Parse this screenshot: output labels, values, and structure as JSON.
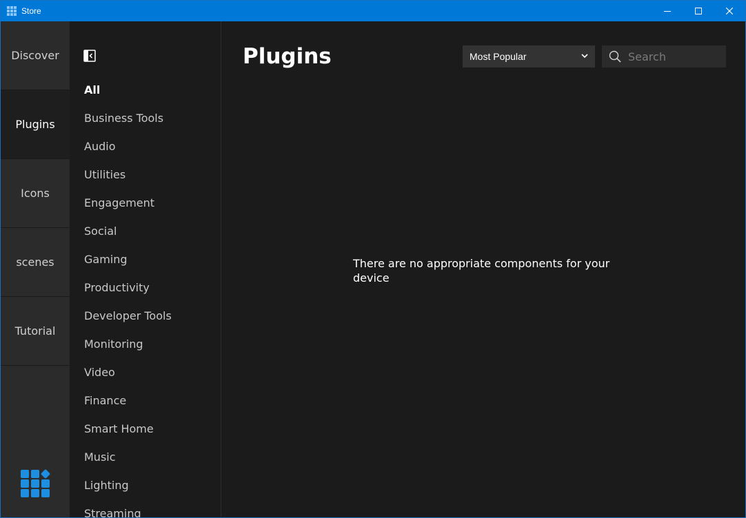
{
  "window": {
    "title": "Store"
  },
  "rail": {
    "items": [
      {
        "label": "Discover"
      },
      {
        "label": "Plugins"
      },
      {
        "label": "Icons"
      },
      {
        "label": "scenes"
      },
      {
        "label": "Tutorial"
      }
    ],
    "active": "Plugins"
  },
  "categories": {
    "items": [
      {
        "label": "All"
      },
      {
        "label": "Business Tools"
      },
      {
        "label": "Audio"
      },
      {
        "label": "Utilities"
      },
      {
        "label": "Engagement"
      },
      {
        "label": "Social"
      },
      {
        "label": "Gaming"
      },
      {
        "label": "Productivity"
      },
      {
        "label": "Developer Tools"
      },
      {
        "label": "Monitoring"
      },
      {
        "label": "Video"
      },
      {
        "label": "Finance"
      },
      {
        "label": "Smart Home"
      },
      {
        "label": "Music"
      },
      {
        "label": "Lighting"
      },
      {
        "label": "Streaming"
      }
    ],
    "active": "All"
  },
  "main": {
    "title": "Plugins",
    "sort": {
      "selected": "Most Popular"
    },
    "search": {
      "placeholder": "Search",
      "value": ""
    },
    "empty_message": "There are no appropriate components for your device"
  },
  "colors": {
    "titlebar": "#0078d7",
    "accent": "#1e8fe0",
    "background": "#1b1b1b",
    "rail": "#2b2b2b"
  }
}
